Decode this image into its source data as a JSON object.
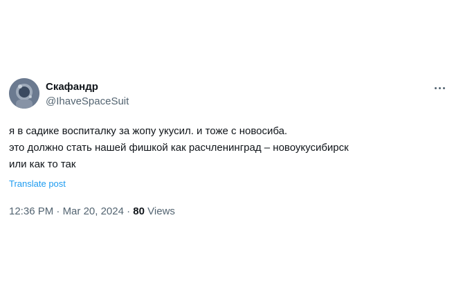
{
  "author": {
    "display_name": "Скафандр",
    "handle": "@IhaveSpaceSuit"
  },
  "tweet": {
    "lines": [
      "я в садике воспиталку за жопу укусил. и тоже с новосиба.",
      "это должно стать нашей фишкой как расчленинград – новоукусибирск",
      "или как то так"
    ],
    "translate_label": "Translate post"
  },
  "meta": {
    "time": "12:36 PM",
    "separator": "·",
    "date": "Mar 20, 2024",
    "views_count": "80",
    "views_label": "Views"
  },
  "icons": {
    "more": "more-horizontal-icon"
  },
  "colors": {
    "text_primary": "#0f1419",
    "text_secondary": "#536471",
    "link": "#1d9bf0"
  }
}
